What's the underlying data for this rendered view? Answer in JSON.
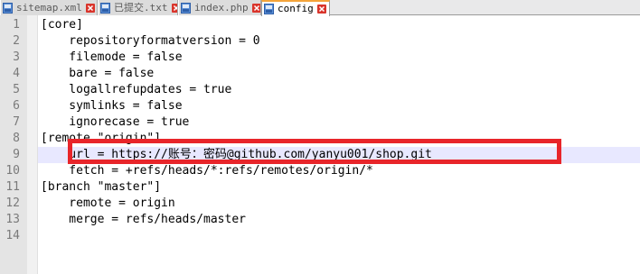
{
  "tabs": [
    {
      "label": "sitemap.xml",
      "active": false
    },
    {
      "label": "已提交.txt",
      "active": false
    },
    {
      "label": "index.php",
      "active": false
    },
    {
      "label": "config",
      "active": true
    }
  ],
  "colors": {
    "accent_tab_top": "#f4a43a",
    "close_icon": "#d9342b",
    "highlight_box": "#e8252a",
    "current_line": "#e8e8ff"
  },
  "editor": {
    "line_numbers": [
      "1",
      "2",
      "3",
      "4",
      "5",
      "6",
      "7",
      "8",
      "9",
      "10",
      "11",
      "12",
      "13",
      "14"
    ],
    "lines": [
      "[core]",
      "    repositoryformatversion = 0",
      "    filemode = false",
      "    bare = false",
      "    logallrefupdates = true",
      "    symlinks = false",
      "    ignorecase = true",
      "[remote \"origin\"]",
      "    url = https://账号：密码@github.com/yanyu001/shop.git",
      "    fetch = +refs/heads/*:refs/remotes/origin/*",
      "[branch \"master\"]",
      "    remote = origin",
      "    merge = refs/heads/master",
      ""
    ]
  }
}
